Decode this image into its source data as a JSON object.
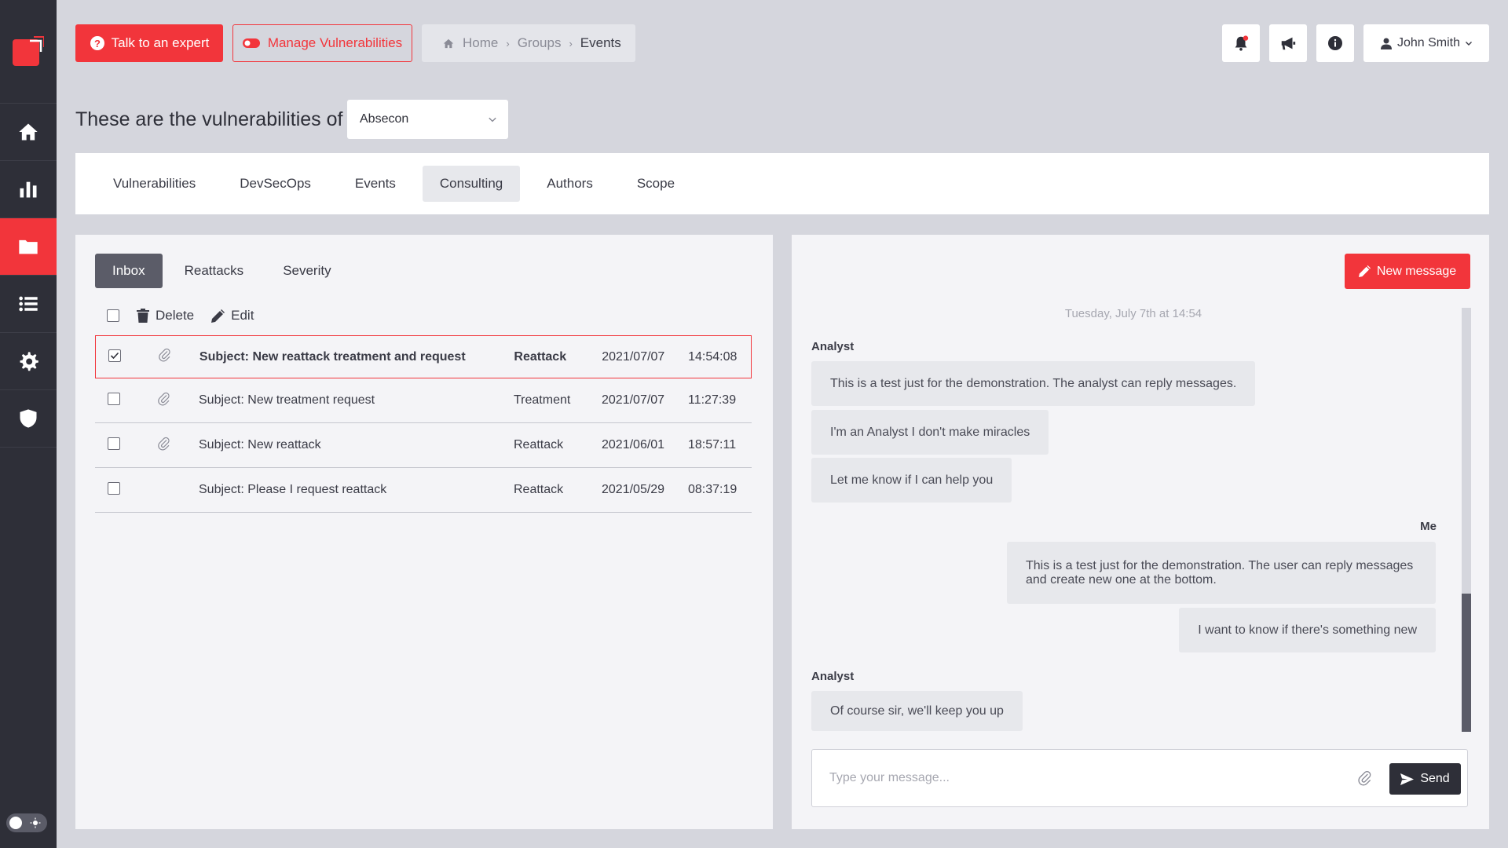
{
  "topbar": {
    "talk_button": "Talk to an expert",
    "manage_button": "Manage Vulnerabilities",
    "breadcrumb": [
      "Home",
      "Groups",
      "Events"
    ],
    "user_name": "John Smith"
  },
  "heading": {
    "text": "These are the vulnerabilities of",
    "selected_group": "Absecon"
  },
  "tabs": [
    "Vulnerabilities",
    "DevSecOps",
    "Events",
    "Consulting",
    "Authors",
    "Scope"
  ],
  "active_tab": "Consulting",
  "inbox": {
    "subtabs": [
      "Inbox",
      "Reattacks",
      "Severity"
    ],
    "active_subtab": "Inbox",
    "actions": {
      "delete": "Delete",
      "edit": "Edit"
    },
    "rows": [
      {
        "subject": "Subject: New reattack treatment and request",
        "type": "Reattack",
        "date": "2021/07/07",
        "time": "14:54:08",
        "attachment": true,
        "checked": true,
        "selected": true
      },
      {
        "subject": "Subject: New treatment request",
        "type": "Treatment",
        "date": "2021/07/07",
        "time": "11:27:39",
        "attachment": true,
        "checked": false,
        "selected": false
      },
      {
        "subject": "Subject: New reattack",
        "type": "Reattack",
        "date": "2021/06/01",
        "time": "18:57:11",
        "attachment": true,
        "checked": false,
        "selected": false
      },
      {
        "subject": "Subject: Please I request reattack",
        "type": "Reattack",
        "date": "2021/05/29",
        "time": "08:37:19",
        "attachment": false,
        "checked": false,
        "selected": false
      }
    ]
  },
  "chat": {
    "new_message_button": "New message",
    "date_line": "Tuesday, July 7th at 14:54",
    "sender_analyst": "Analyst",
    "sender_me": "Me",
    "messages": [
      "This is a test just for the demonstration. The analyst can reply messages.",
      "I'm an Analyst I don't make miracles",
      "Let me know if I can help you",
      "This is a test just for the demonstration. The user can reply messages and create new one at the bottom.",
      "I want to know if there's something new",
      "Of course sir, we'll keep you up"
    ],
    "input_placeholder": "Type your message...",
    "send_button": "Send"
  },
  "colors": {
    "accent": "#f2353b",
    "sidebar": "#2e2f38",
    "background": "#d5d6dd",
    "panel": "#f4f4f7"
  },
  "icons": {
    "sidebar": [
      "home-icon",
      "chart-icon",
      "folder-icon",
      "list-icon",
      "gear-icon",
      "shield-icon"
    ],
    "topbar": [
      "bell-icon",
      "megaphone-icon",
      "info-icon",
      "user-icon"
    ]
  }
}
